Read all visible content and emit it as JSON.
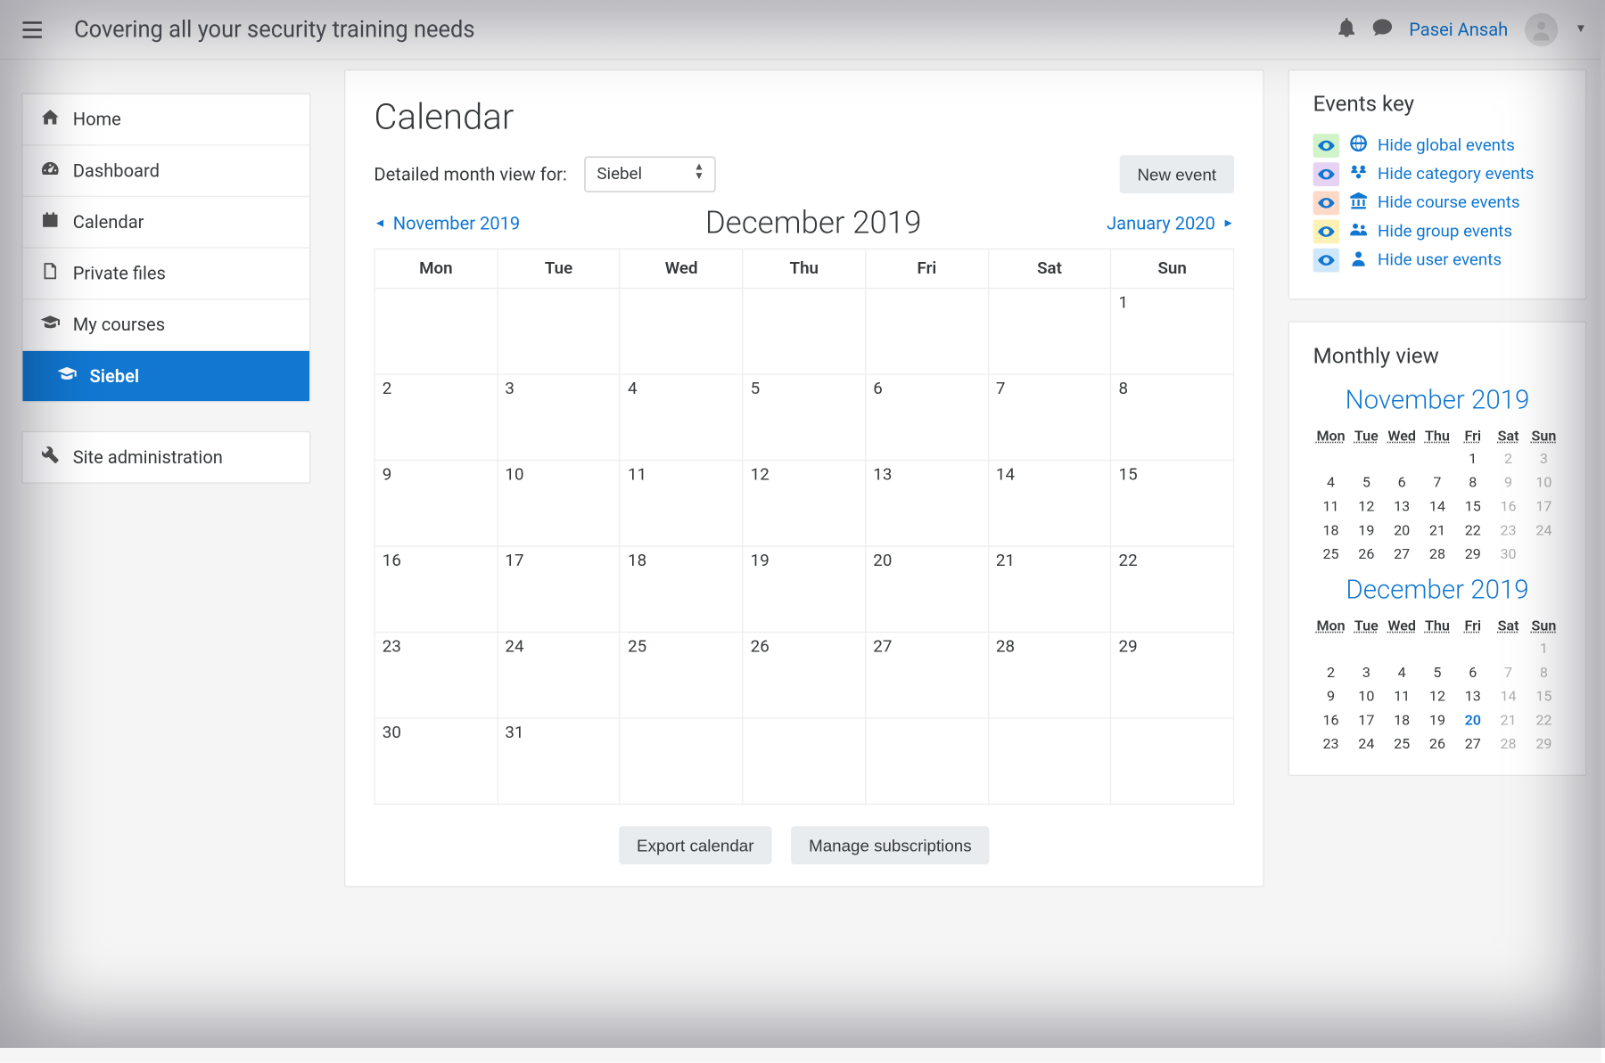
{
  "header": {
    "brand": "Covering all your security training needs",
    "username": "Pasei Ansah"
  },
  "sidebar": {
    "items": [
      {
        "icon": "home-icon",
        "label": "Home"
      },
      {
        "icon": "gauge-icon",
        "label": "Dashboard"
      },
      {
        "icon": "calendar-icon",
        "label": "Calendar"
      },
      {
        "icon": "file-icon",
        "label": "Private files"
      },
      {
        "icon": "grad-cap-icon",
        "label": "My courses"
      },
      {
        "icon": "grad-cap-icon",
        "label": "Siebel"
      }
    ],
    "admin_label": "Site administration"
  },
  "calendar": {
    "title": "Calendar",
    "detail_label": "Detailed month view for:",
    "course_selected": "Siebel",
    "new_event_label": "New event",
    "prev_month": "November 2019",
    "current_month": "December 2019",
    "next_month": "January 2020",
    "weekdays": [
      "Mon",
      "Tue",
      "Wed",
      "Thu",
      "Fri",
      "Sat",
      "Sun"
    ],
    "weeks": [
      [
        "",
        "",
        "",
        "",
        "",
        "",
        "1"
      ],
      [
        "2",
        "3",
        "4",
        "5",
        "6",
        "7",
        "8"
      ],
      [
        "9",
        "10",
        "11",
        "12",
        "13",
        "14",
        "15"
      ],
      [
        "16",
        "17",
        "18",
        "19",
        "20",
        "21",
        "22"
      ],
      [
        "23",
        "24",
        "25",
        "26",
        "27",
        "28",
        "29"
      ],
      [
        "30",
        "31",
        "",
        "",
        "",
        "",
        ""
      ]
    ],
    "export_label": "Export calendar",
    "manage_label": "Manage subscriptions"
  },
  "events_key": {
    "title": "Events key",
    "items": [
      {
        "bg": "#d0f3c9",
        "icon": "globe-icon",
        "label": "Hide global events"
      },
      {
        "bg": "#e6d3f3",
        "icon": "category-icon",
        "label": "Hide category events"
      },
      {
        "bg": "#ffd9c7",
        "icon": "bank-icon",
        "label": "Hide course events"
      },
      {
        "bg": "#fff1b3",
        "icon": "users-icon",
        "label": "Hide group events"
      },
      {
        "bg": "#cfe7fb",
        "icon": "user-icon",
        "label": "Hide user events"
      }
    ]
  },
  "monthly_view": {
    "title": "Monthly view",
    "weekdays": [
      "Mon",
      "Tue",
      "Wed",
      "Thu",
      "Fri",
      "Sat",
      "Sun"
    ],
    "months": [
      {
        "name": "November 2019",
        "today": null,
        "weeks": [
          [
            null,
            null,
            null,
            null,
            {
              "d": "1"
            },
            {
              "d": "2",
              "dim": true
            },
            {
              "d": "3",
              "dim": true
            }
          ],
          [
            {
              "d": "4"
            },
            {
              "d": "5"
            },
            {
              "d": "6"
            },
            {
              "d": "7"
            },
            {
              "d": "8"
            },
            {
              "d": "9",
              "dim": true
            },
            {
              "d": "10",
              "dim": true
            }
          ],
          [
            {
              "d": "11"
            },
            {
              "d": "12"
            },
            {
              "d": "13"
            },
            {
              "d": "14"
            },
            {
              "d": "15"
            },
            {
              "d": "16",
              "dim": true
            },
            {
              "d": "17",
              "dim": true
            }
          ],
          [
            {
              "d": "18"
            },
            {
              "d": "19"
            },
            {
              "d": "20"
            },
            {
              "d": "21"
            },
            {
              "d": "22"
            },
            {
              "d": "23",
              "dim": true
            },
            {
              "d": "24",
              "dim": true
            }
          ],
          [
            {
              "d": "25"
            },
            {
              "d": "26"
            },
            {
              "d": "27"
            },
            {
              "d": "28"
            },
            {
              "d": "29"
            },
            {
              "d": "30",
              "dim": true
            },
            null
          ]
        ]
      },
      {
        "name": "December 2019",
        "today": "20",
        "weeks": [
          [
            null,
            null,
            null,
            null,
            null,
            null,
            {
              "d": "1",
              "dim": true
            }
          ],
          [
            {
              "d": "2"
            },
            {
              "d": "3"
            },
            {
              "d": "4"
            },
            {
              "d": "5"
            },
            {
              "d": "6"
            },
            {
              "d": "7",
              "dim": true
            },
            {
              "d": "8",
              "dim": true
            }
          ],
          [
            {
              "d": "9"
            },
            {
              "d": "10"
            },
            {
              "d": "11"
            },
            {
              "d": "12"
            },
            {
              "d": "13"
            },
            {
              "d": "14",
              "dim": true
            },
            {
              "d": "15",
              "dim": true
            }
          ],
          [
            {
              "d": "16"
            },
            {
              "d": "17"
            },
            {
              "d": "18"
            },
            {
              "d": "19"
            },
            {
              "d": "20"
            },
            {
              "d": "21",
              "dim": true
            },
            {
              "d": "22",
              "dim": true
            }
          ],
          [
            {
              "d": "23"
            },
            {
              "d": "24"
            },
            {
              "d": "25"
            },
            {
              "d": "26"
            },
            {
              "d": "27"
            },
            {
              "d": "28",
              "dim": true
            },
            {
              "d": "29",
              "dim": true
            }
          ]
        ]
      }
    ]
  },
  "colors": {
    "link": "#1177d1"
  }
}
